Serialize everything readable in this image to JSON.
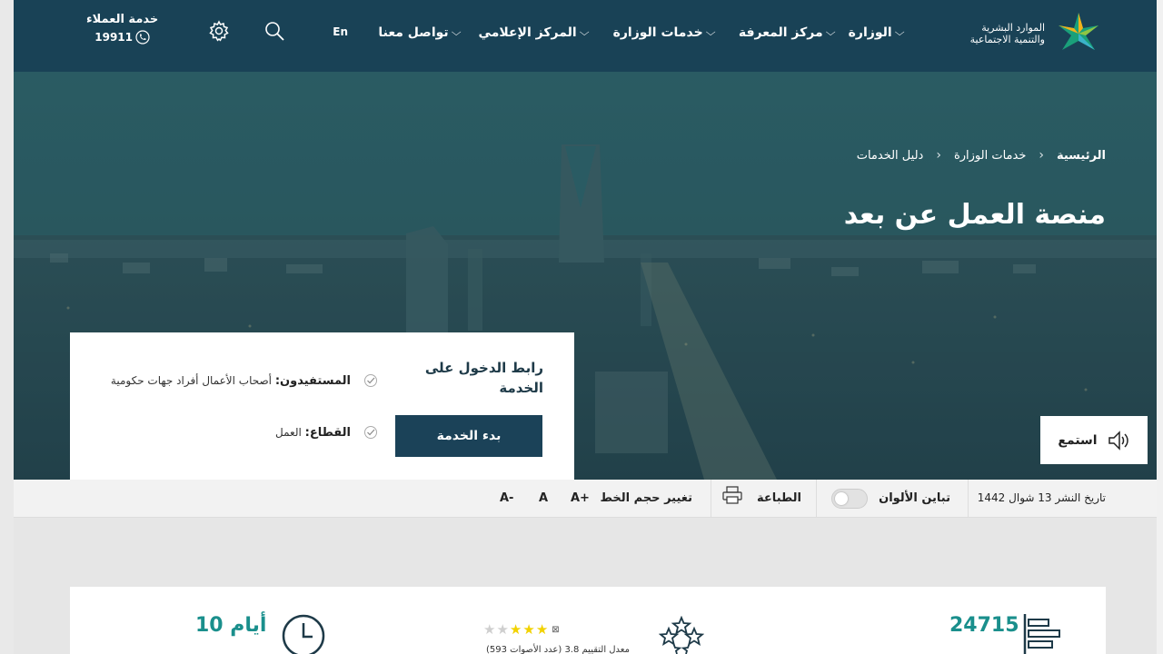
{
  "header": {
    "logo_line1": "الموارد البشرية",
    "logo_line2": "والتنمية الاجتماعية",
    "nav": [
      {
        "label": "الوزارة"
      },
      {
        "label": "مركز المعرفة"
      },
      {
        "label": "خدمات الوزارة"
      },
      {
        "label": "المركز الإعلامي"
      },
      {
        "label": "تواصل معنا"
      }
    ],
    "lang_label": "En",
    "customer_service_label": "خدمة العملاء",
    "customer_service_phone": "19911"
  },
  "breadcrumb": [
    "الرئيسية",
    "خدمات الوزارة",
    "دليل الخدمات"
  ],
  "page_title": "منصة العمل عن بعد",
  "listen_label": "استمع",
  "service_card": {
    "link_title": "رابط الدخول على الخدمة",
    "start_button": "بدء الخدمة",
    "beneficiaries_label": "المستفيدون:",
    "beneficiaries_value": "أصحاب الأعمال أفراد جهات حكومية",
    "sector_label": "القطاع:",
    "sector_value": "العمل"
  },
  "tools": {
    "publish_date": "تاريخ النشر 13 شوال 1442",
    "contrast_label": "تباين الألوان",
    "print_label": "الطباعة",
    "font_size_label": "تغيير حجم الخط",
    "font_plus": "A+",
    "font_normal": "A",
    "font_minus": "A-"
  },
  "stats": {
    "visits": "24715",
    "duration": "10 أيام",
    "rating_value": 3,
    "rating_max": 5,
    "rating_note": "معدل التقييم 3.8 (عدد الأصوات 593)"
  },
  "colors": {
    "header_bg": "#194256",
    "accent_teal": "#1a8f8c",
    "button_bg": "#1b4258",
    "star": "#f2d200"
  }
}
